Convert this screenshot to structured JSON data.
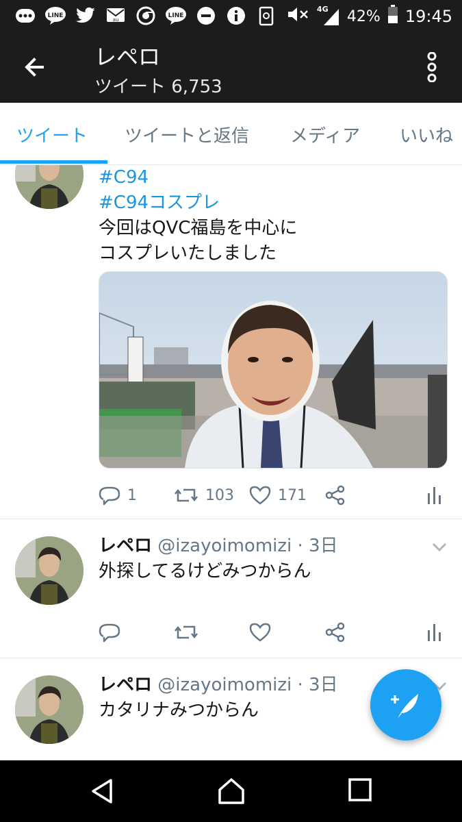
{
  "status_bar": {
    "notification_icons": [
      "more-icon",
      "line-icon",
      "twitter-icon",
      "au-mail-icon",
      "chrome-icon",
      "line-icon",
      "minus-circle-icon",
      "info-icon",
      "clipboard-icon"
    ],
    "network": "4G",
    "battery": "42%",
    "time": "19:45"
  },
  "header": {
    "title": "レペロ",
    "subtitle": "ツイート 6,753"
  },
  "tabs": [
    {
      "label": "ツイート",
      "active": true
    },
    {
      "label": "ツイートと返信",
      "active": false
    },
    {
      "label": "メディア",
      "active": false
    },
    {
      "label": "いいね",
      "active": false
    }
  ],
  "tweets": [
    {
      "hashtags": [
        "#C94",
        "#C94コスプレ"
      ],
      "text_lines": [
        "今回はQVC福島を中心に",
        "コスプレいたしました"
      ],
      "has_media": true,
      "reply_count": "1",
      "retweet_count": "103",
      "like_count": "171"
    },
    {
      "name": "レペロ",
      "handle_time": "@izayoimomizi · 3日",
      "text": "外探してるけどみつからん"
    },
    {
      "name": "レペロ",
      "handle_time": "@izayoimomizi · 3日",
      "text": "カタリナみつからん"
    }
  ],
  "colors": {
    "accent": "#1da1f2",
    "dark_bar": "#1c1c1a",
    "muted": "#657786"
  }
}
